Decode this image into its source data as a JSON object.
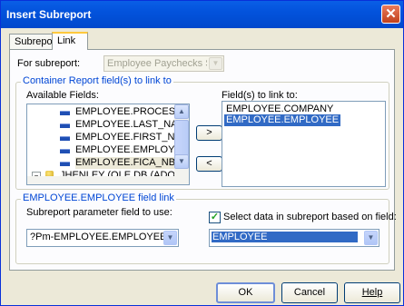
{
  "window": {
    "title": "Insert Subreport"
  },
  "tabs": [
    {
      "label": "Subreport"
    },
    {
      "label": "Link"
    }
  ],
  "for_subreport": {
    "label": "For subreport:",
    "value": "Employee Paychecks Subrep"
  },
  "container_group": {
    "legend": "Container Report field(s) to link to"
  },
  "available_fields": {
    "label": "Available Fields:",
    "items": [
      "EMPLOYEE.PROCESS_",
      "EMPLOYEE.LAST_NA",
      "EMPLOYEE.FIRST_NA",
      "EMPLOYEE.EMPLOYEI",
      "EMPLOYEE.FICA_NBR",
      "JHENLEY (OLE DB (ADO))"
    ]
  },
  "linked_fields": {
    "label": "Field(s) to link to:",
    "items": [
      "EMPLOYEE.COMPANY",
      "EMPLOYEE.EMPLOYEE"
    ],
    "selected_index": 1
  },
  "move_buttons": {
    "add": ">",
    "remove": "<"
  },
  "link_group": {
    "legend": "EMPLOYEE.EMPLOYEE field link"
  },
  "param_field": {
    "label": "Subreport parameter field to use:",
    "value": "?Pm-EMPLOYEE.EMPLOYEE"
  },
  "select_data": {
    "label": "Select data in subreport based on field:",
    "checked": true,
    "value": "EMPLOYEE"
  },
  "buttons": {
    "ok": "OK",
    "cancel": "Cancel",
    "help": "Help"
  },
  "colors": {
    "titlebar": "#0353dc",
    "selection": "#316ac5",
    "dialog_bg": "#ece9d8",
    "group_legend": "#0046d5"
  }
}
